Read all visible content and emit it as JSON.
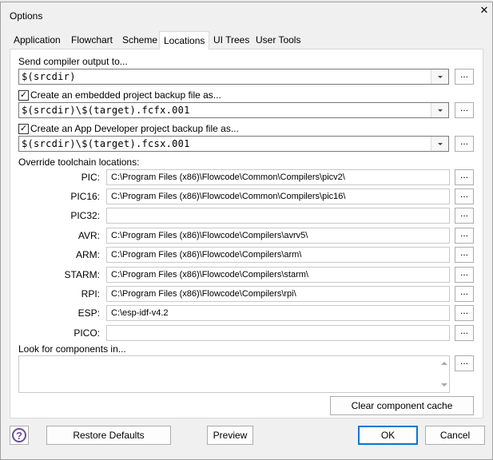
{
  "window": {
    "title": "Options",
    "close_icon": "close-icon"
  },
  "tabs": [
    {
      "label": "Application"
    },
    {
      "label": "Flowchart"
    },
    {
      "label": "Scheme"
    },
    {
      "label": "Locations",
      "active": true
    },
    {
      "label": "UI Trees"
    },
    {
      "label": "User Tools"
    }
  ],
  "locations": {
    "compiler_output": {
      "label": "Send compiler output to...",
      "value": "$(srcdir)"
    },
    "embedded_backup": {
      "label": "Create an embedded project backup file as...",
      "checked": true,
      "value": "$(srcdir)\\$(target).fcfx.001"
    },
    "appdev_backup": {
      "label": "Create an App Developer project backup file as...",
      "checked": true,
      "value": "$(srcdir)\\$(target).fcsx.001"
    },
    "override_label": "Override toolchain locations:",
    "toolchains": [
      {
        "name": "PIC:",
        "path": "C:\\Program Files (x86)\\Flowcode\\Common\\Compilers\\picv2\\"
      },
      {
        "name": "PIC16:",
        "path": "C:\\Program Files (x86)\\Flowcode\\Common\\Compilers\\pic16\\"
      },
      {
        "name": "PIC32:",
        "path": ""
      },
      {
        "name": "AVR:",
        "path": "C:\\Program Files (x86)\\Flowcode\\Compilers\\avrv5\\"
      },
      {
        "name": "ARM:",
        "path": "C:\\Program Files (x86)\\Flowcode\\Compilers\\arm\\"
      },
      {
        "name": "STARM:",
        "path": "C:\\Program Files (x86)\\Flowcode\\Compilers\\starm\\"
      },
      {
        "name": "RPI:",
        "path": "C:\\Program Files (x86)\\Flowcode\\Compilers\\rpi\\"
      },
      {
        "name": "ESP:",
        "path": "C:\\esp-idf-v4.2"
      },
      {
        "name": "PICO:",
        "path": ""
      }
    ],
    "components_label": "Look for components in...",
    "components_value": "",
    "clear_cache_label": "Clear component cache",
    "browse_label": "..."
  },
  "footer": {
    "help_icon": "?",
    "restore_label": "Restore Defaults",
    "preview_label": "Preview",
    "ok_label": "OK",
    "cancel_label": "Cancel"
  },
  "colors": {
    "accent": "#0078d7",
    "help_icon": "#6b4c9a"
  }
}
